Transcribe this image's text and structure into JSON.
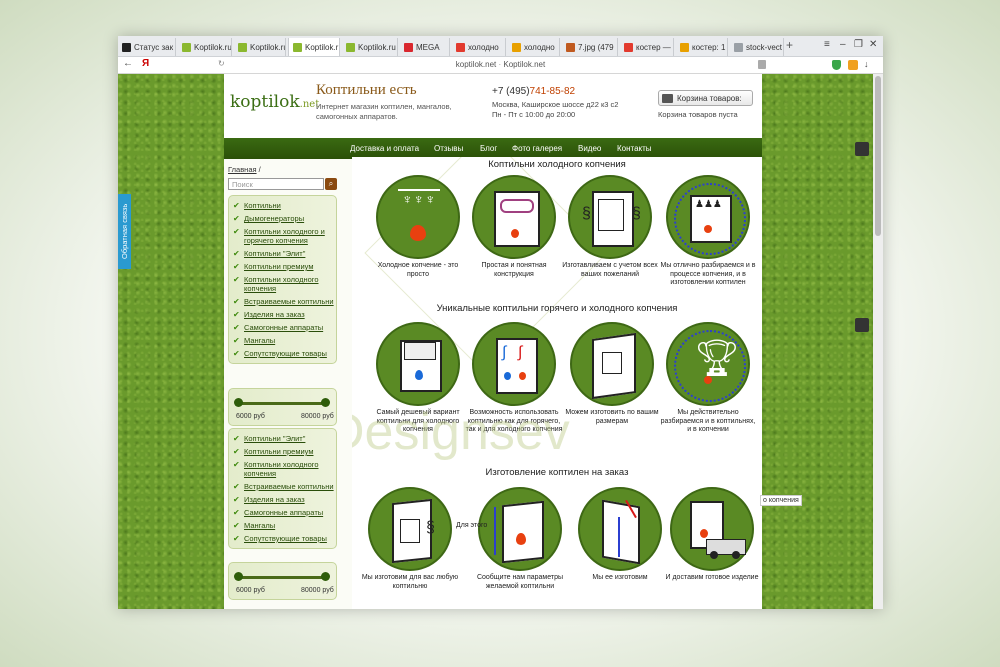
{
  "browser": {
    "tabs": [
      {
        "label": "Статус зак",
        "icon": "k-icon",
        "color": "#222222"
      },
      {
        "label": "Koptilok.ru",
        "icon": "leaf-icon",
        "color": "#8bb82f"
      },
      {
        "label": "Koptilok.ru",
        "icon": "leaf-icon",
        "color": "#8bb82f"
      },
      {
        "label": "Koptilok.r",
        "icon": "leaf-icon",
        "color": "#8bb82f",
        "active": true
      },
      {
        "label": "Koptilok.ru",
        "icon": "leaf-icon",
        "color": "#8bb82f"
      },
      {
        "label": "MEGA",
        "icon": "mega-icon",
        "color": "#d9272e"
      },
      {
        "label": "холодно",
        "icon": "yandex-icon",
        "color": "#e23a2e"
      },
      {
        "label": "холодно",
        "icon": "yandex-images-icon",
        "color": "#e8a000"
      },
      {
        "label": "7.jpg (479",
        "icon": "image-icon",
        "color": "#c05a20"
      },
      {
        "label": "костер —",
        "icon": "yandex-icon",
        "color": "#e23a2e"
      },
      {
        "label": "костер: 1",
        "icon": "yandex-images-icon",
        "color": "#e8a000"
      },
      {
        "label": "stock-vect",
        "icon": "page-icon",
        "color": "#9aa0a6"
      }
    ],
    "url_host": "koptilok.net",
    "url_title": "Koptilok.net"
  },
  "site": {
    "logo_main": "koptilok",
    "logo_suffix": ".net",
    "name": "Коптильни есть",
    "description": "Интернет магазин коптилен, мангалов, самогонных аппаратов.",
    "phone_prefix": "+7 (495)",
    "phone_number": "741-85-82",
    "address": "Москва, Каширское шоссе д22 к3 с2",
    "hours": "Пн - Пт с 10:00 до 20:00",
    "cart_button": "Корзина товаров:",
    "cart_status": "Корзина товаров пуста"
  },
  "nav": [
    "Доставка и оплата",
    "Отзывы",
    "Блог",
    "Фото галерея",
    "Видео",
    "Контакты"
  ],
  "breadcrumb": "Главная",
  "search_placeholder": "Поиск",
  "menu1": [
    "Коптильни",
    "Дымогенераторы",
    "Коптильни холодного и горячего копчения",
    "Коптильни \"Элит\"",
    "Коптильни премиум",
    "Коптильни холодного копчения",
    "Встраиваемые коптильни",
    "Изделия на заказ",
    "Самогонные аппараты",
    "Мангалы",
    "Сопутствующие товары"
  ],
  "menu2": [
    "Коптильни \"Элит\"",
    "Коптильни премиум",
    "Коптильни холодного копчения",
    "Встраиваемые коптильни",
    "Изделия на заказ",
    "Самогонные аппараты",
    "Мангалы",
    "Сопутствующие товары"
  ],
  "price": {
    "min": "6000 руб",
    "max": "80000 руб"
  },
  "sections": [
    {
      "title": "Коптильни холодного копчения",
      "cards": [
        {
          "icon": "fish-fire-icon",
          "caption": "Холодное копчение - это просто"
        },
        {
          "icon": "smoker-box-icon",
          "caption": "Простая и понятная конструкция"
        },
        {
          "icon": "cabinet-icon",
          "caption": "Изготавливаем с учетом всех ваших пожеланий"
        },
        {
          "icon": "expert-stars-icon",
          "caption": "Мы отлично разбираемся и в процессе копчения, и в изготовлении коптилен"
        }
      ]
    },
    {
      "title": "Уникальные коптильни горячего и холодного копчения",
      "cards": [
        {
          "icon": "budget-smoker-icon",
          "caption": "Самый дешевый вариант коптильни для холодного копчения"
        },
        {
          "icon": "hot-cold-icon",
          "caption": "Возможность использовать коптильню как для горячего, так и для холодного копчения"
        },
        {
          "icon": "custom-size-icon",
          "caption": "Можем изготовить по вашим размерам"
        },
        {
          "icon": "trophy-icon",
          "caption": "Мы действительно разбираемся и в коптильнях, и в копчении"
        }
      ]
    },
    {
      "title": "Изготовление коптилен на заказ",
      "cards": [
        {
          "icon": "smoker-3d-icon",
          "caption": "Мы изготовим для вас любую коптильню"
        },
        {
          "icon": "measure-icon",
          "caption": "Сообщите нам параметры желаемой коптильни"
        },
        {
          "icon": "sheet-metal-icon",
          "caption": "Мы ее изготовим"
        },
        {
          "icon": "delivery-truck-icon",
          "caption": "И доставим готовое изделие"
        }
      ]
    }
  ],
  "side_note": "Для этого",
  "watermark": "Designsev",
  "feedback": "Обратная связь",
  "tooltip": "о копчения",
  "colors": {
    "accent": "#3a6a12",
    "circle": "#5a8a24",
    "phone": "#c04000"
  }
}
